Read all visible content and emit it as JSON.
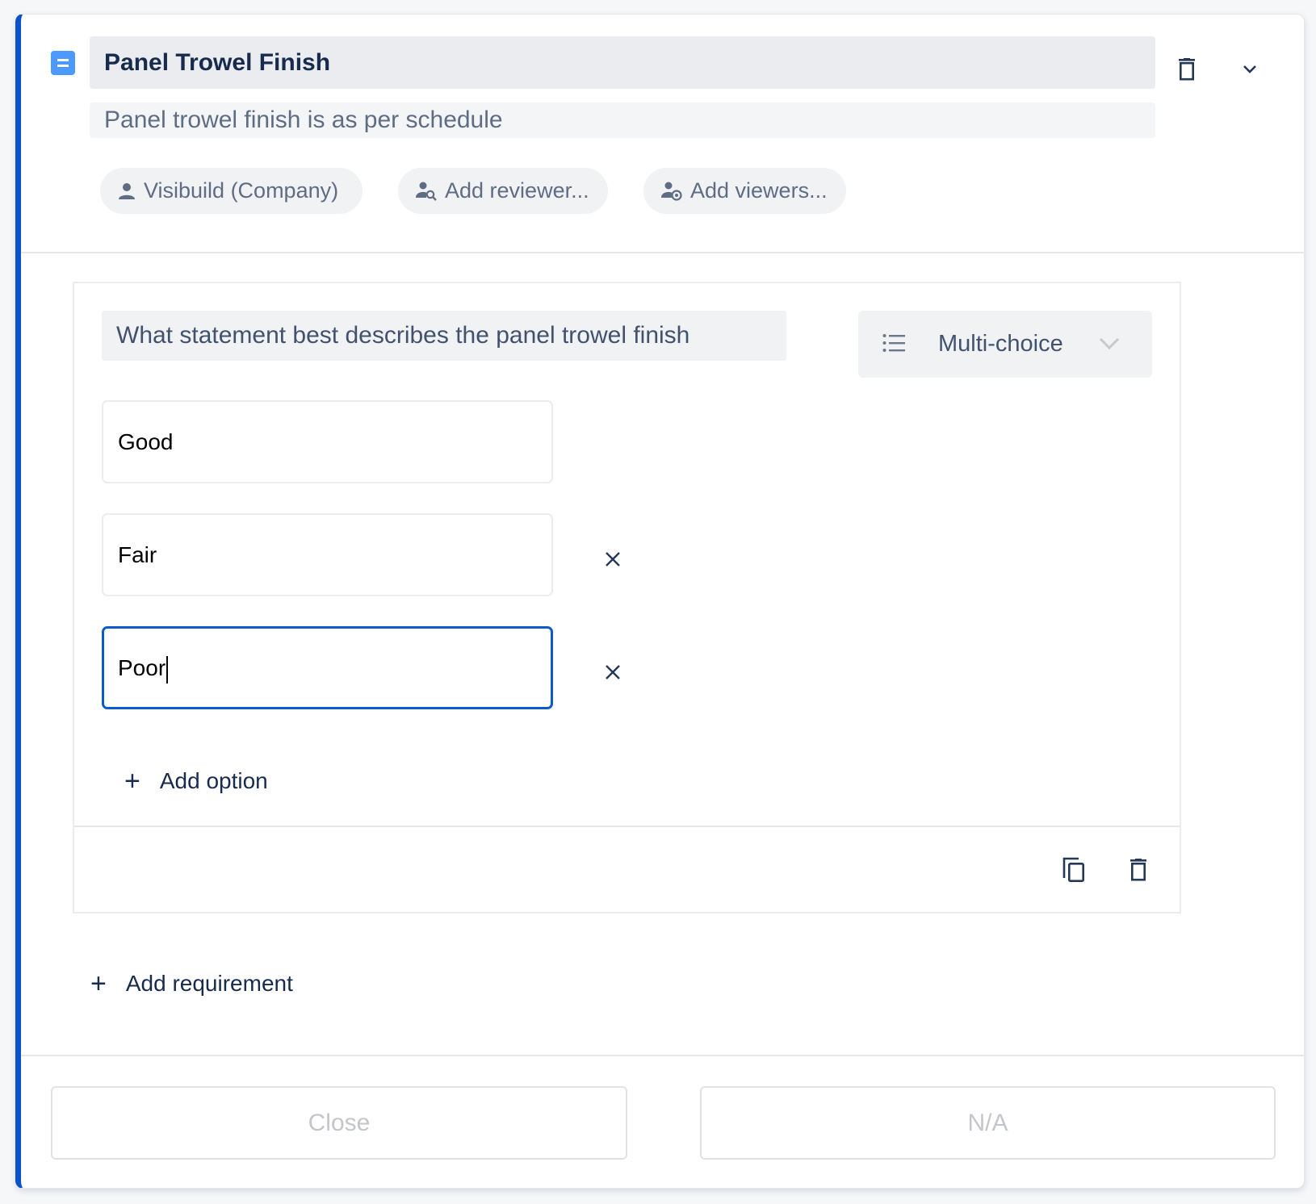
{
  "item": {
    "type_icon": "text-item-icon",
    "title": "Panel Trowel Finish",
    "description": "Panel trowel finish is as per schedule",
    "delete_icon": "trash-icon",
    "collapse_icon": "chevron-down-icon",
    "accent_color": "#0a52cc"
  },
  "assignees": {
    "owner": {
      "icon": "person-icon",
      "label": "Visibuild (Company)"
    },
    "reviewer": {
      "icon": "person-search-icon",
      "label": "Add reviewer..."
    },
    "viewers": {
      "icon": "person-eye-icon",
      "label": "Add viewers..."
    }
  },
  "requirement": {
    "question": "What statement best describes the panel trowel finish",
    "response_type": {
      "icon": "list-icon",
      "label": "Multi-choice",
      "chevron": "chevron-down-icon"
    },
    "options": [
      {
        "value": "Good",
        "removable": false,
        "focused": false
      },
      {
        "value": "Fair",
        "removable": true,
        "focused": false
      },
      {
        "value": "Poor",
        "removable": true,
        "focused": true
      }
    ],
    "add_option_label": "Add option",
    "duplicate_icon": "copy-icon",
    "delete_icon": "trash-icon"
  },
  "add_requirement_label": "Add requirement",
  "footer": {
    "close_label": "Close",
    "na_label": "N/A"
  }
}
